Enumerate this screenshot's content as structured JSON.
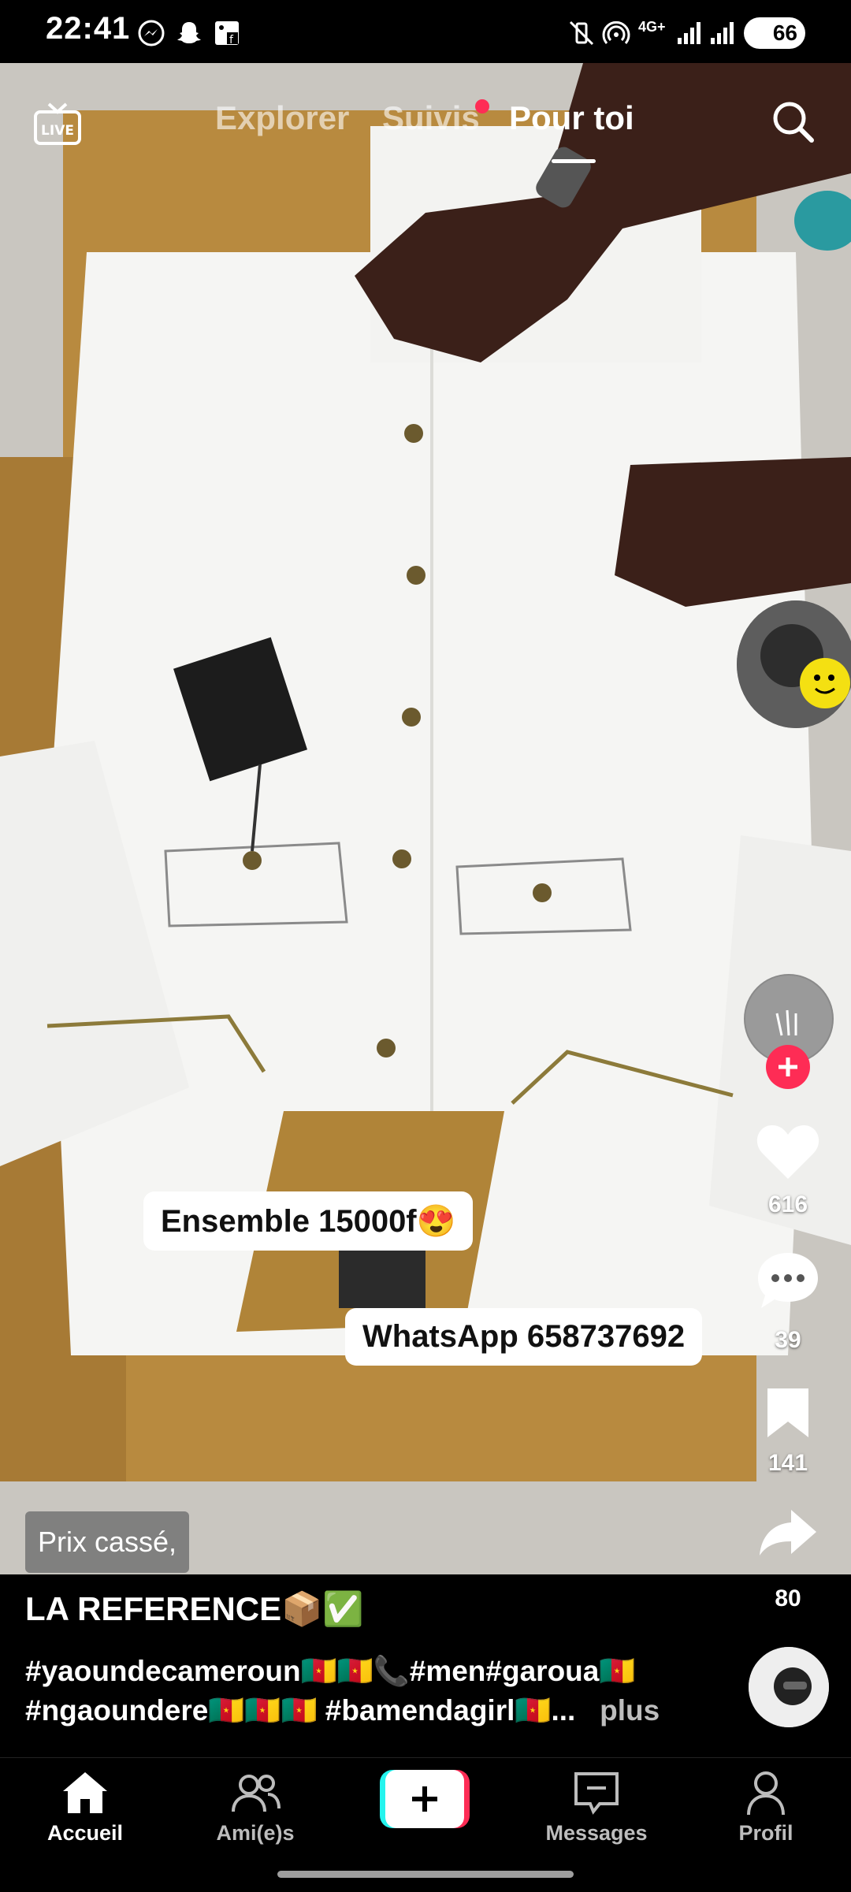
{
  "status_bar": {
    "time": "22:41",
    "battery": "66",
    "network": "4G+"
  },
  "top_nav": {
    "live_label": "LIVE",
    "tabs": [
      {
        "label": "Explorer"
      },
      {
        "label": "Suivis"
      },
      {
        "label": "Pour toi"
      }
    ],
    "active_tab": "Pour toi"
  },
  "video": {
    "captions": [
      "Ensemble 15000f😍",
      "WhatsApp 658737692"
    ],
    "price_tag": "Prix cassé,"
  },
  "right_rail": {
    "likes": "616",
    "comments": "39",
    "saves": "141",
    "shares": "80"
  },
  "post": {
    "author": "LA REFERENCE📦✅",
    "description_line1": "#yaoundecameroun🇨🇲🇨🇲📞#men#garoua🇨🇲",
    "description_line2": "#ngaoundere🇨🇲🇨🇲🇨🇲 #bamendagirl🇨🇲...",
    "more_label": "plus"
  },
  "bottom_nav": {
    "items": [
      {
        "label": "Accueil"
      },
      {
        "label": "Ami(e)s"
      },
      {
        "label": "Messages"
      },
      {
        "label": "Profil"
      }
    ]
  },
  "colors": {
    "accent": "#fe2c55",
    "create_cyan": "#25f4ee"
  }
}
